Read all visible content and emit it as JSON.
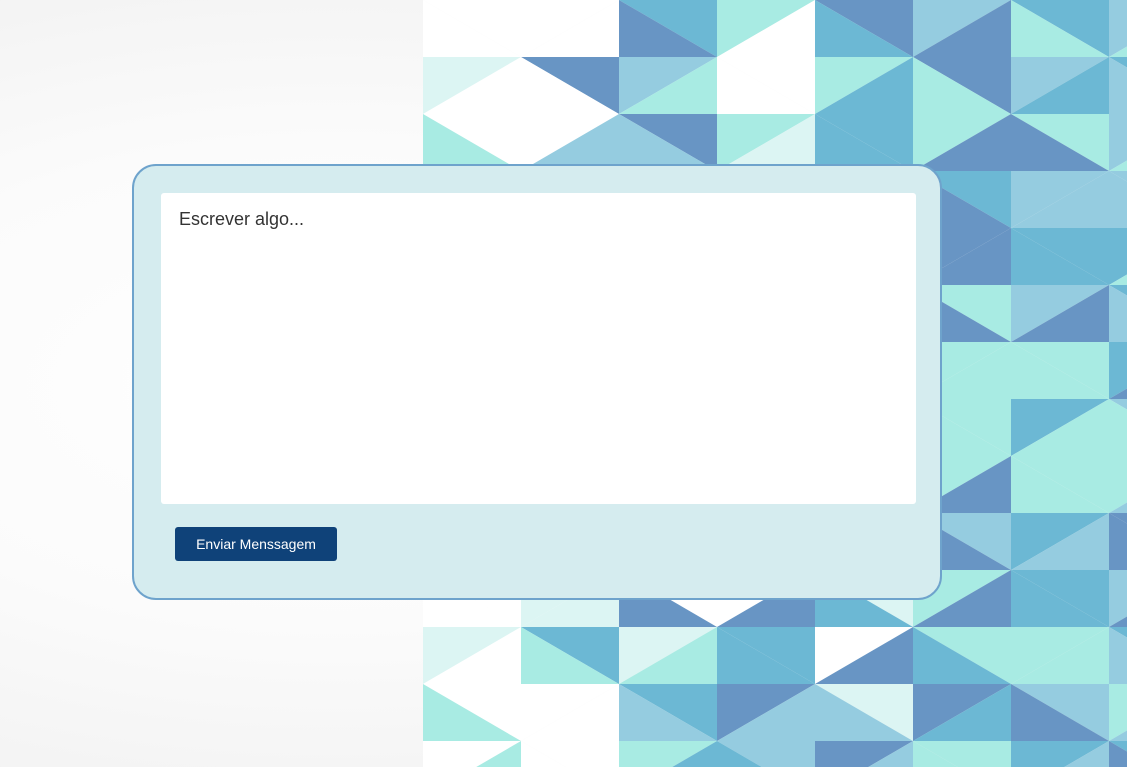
{
  "form": {
    "message_placeholder": "Escrever algo...",
    "message_value": "",
    "send_label": "Enviar Menssagem"
  },
  "colors": {
    "card_background": "#d5ecef",
    "card_border": "#6ea3cc",
    "button_background": "#0f4279",
    "button_text": "#ffffff",
    "pattern_palette": [
      "#a8ebe3",
      "#95cce0",
      "#6cb8d4",
      "#6895c4",
      "#dcf5f3",
      "#ffffff"
    ]
  },
  "background": {
    "pattern": "triangle-mosaic"
  }
}
